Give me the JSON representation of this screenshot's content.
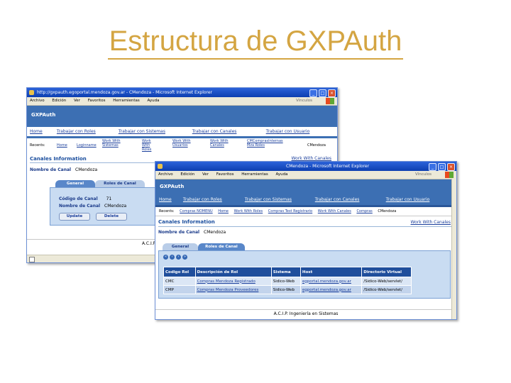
{
  "slide": {
    "title": "Estructura de GXPAuth"
  },
  "back_window": {
    "title": "http://gxpauth.egoportal.mendoza.gov.ar - CMendoza - Microsoft Internet Explorer",
    "menu": [
      "Archivo",
      "Edición",
      "Ver",
      "Favoritos",
      "Herramientas",
      "Ayuda"
    ],
    "menu_brand": "Vínculos",
    "app_header": "GXPAuth",
    "nav": [
      "Home",
      "Trabajar con Roles",
      "Trabajar con Sistemas",
      "Trabajar con Canales",
      "Trabajar con Usuario"
    ],
    "recents_label": "Recents:",
    "recents": [
      "Home",
      "Loginname",
      "Work With Sistemas",
      "Work With Roles",
      "Work With Usuarios",
      "Work With Canales",
      "CMComprasInternas Mza Roles"
    ],
    "recents_current": "CMendoza",
    "section_title": "Canales Information",
    "section_link": "Work With Canales",
    "canal_label": "Nombre de Canal",
    "canal_value": "CMendoza",
    "tabs": [
      "General",
      "Roles de Canal"
    ],
    "fields": [
      {
        "label": "Código de Canal",
        "value": "71"
      },
      {
        "label": "Nombre de Canal",
        "value": "CMendoza"
      }
    ],
    "buttons": [
      "Update",
      "Delete"
    ],
    "footer": "A.C.I.P."
  },
  "front_window": {
    "title": "CMendoza - Microsoft Internet Explorer",
    "menu": [
      "Archivo",
      "Edición",
      "Ver",
      "Favoritos",
      "Herramientas",
      "Ayuda"
    ],
    "menu_brand": "Vínculos",
    "app_header": "GXPAuth",
    "nav": [
      "Home",
      "Trabajar con Roles",
      "Trabajar con Sistemas",
      "Trabajar con Canales",
      "Trabajar con Usuario"
    ],
    "recents_label": "Recents:",
    "recents": [
      "Compras NOMENU",
      "Home",
      "Work With Roles",
      "Compras Test Registrario",
      "Work With Canales",
      "Compras"
    ],
    "recents_current": "CMendoza",
    "section_title": "Canales Information",
    "section_link": "Work With Canales",
    "canal_label": "Nombre de Canal",
    "canal_value": "CMendoza",
    "tabs": [
      "General",
      "Roles de Canal"
    ],
    "pager": [
      "«",
      "‹",
      "›",
      "»"
    ],
    "table": {
      "headers": [
        "Codigo Rol",
        "Descripción de Rol",
        "Sistema",
        "Host",
        "Directorio Virtual"
      ],
      "rows": [
        [
          "CMC",
          "Compras Mendoza Registrado",
          "Sidico-Web",
          "egportal.mendoza.gov.ar",
          "/Sidico-Web/servlet/"
        ],
        [
          "CMP",
          "Compras Mendoza Proveedores",
          "Sidico-Web",
          "egportal.mendoza.gov.ar",
          "/Sidico-Web/servlet/"
        ]
      ]
    },
    "footer": "A.C.I.P. Ingeniería en Sistemas"
  },
  "colors": {
    "title": "#d4a542",
    "header_blue": "#3c6fb3",
    "table_header": "#1f4e9c"
  }
}
